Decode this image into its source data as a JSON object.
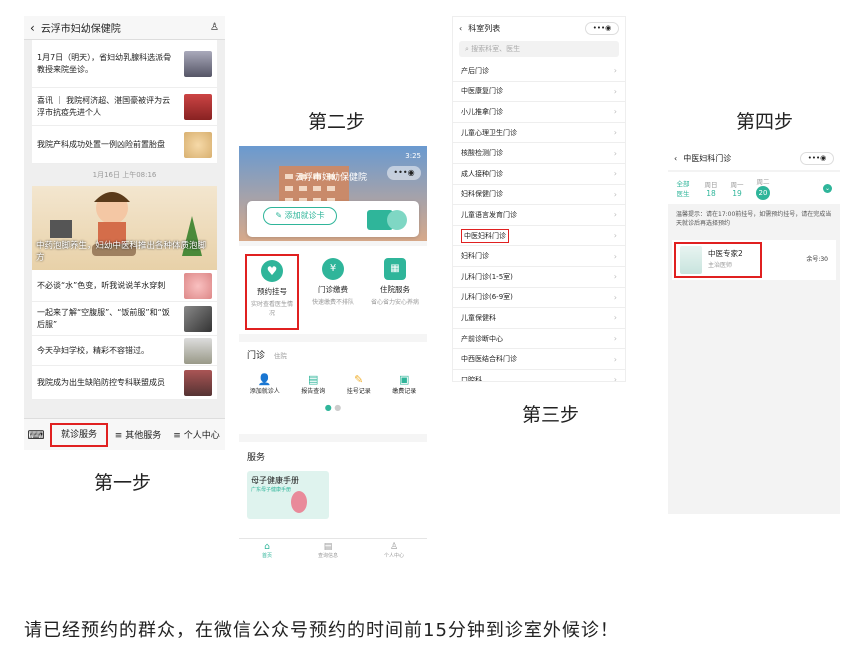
{
  "steps": {
    "s1": "第一步",
    "s2": "第二步",
    "s3": "第三步",
    "s4": "第四步"
  },
  "caption": "请已经预约的群众，在微信公众号预约的时间前15分钟到诊室外候诊！",
  "panel1": {
    "title": "云浮市妇幼保健院",
    "news_top": [
      "1月7日（明天），省妇幼乳腺科选派骨",
      "教授来院坐诊。"
    ],
    "news": [
      "喜讯 ｜ 我院柯济超、湛国豪被评为云浮市抗疫先进个人",
      "我院产科成功处置一例凶险前置胎盘"
    ],
    "timestamp": "1月16日 上午08:16",
    "banner_title": "中药泡脚养生，妇幼中医科推出各种体质泡脚方",
    "news2": [
      "不必谈“水”色变，听我说说羊水穿刺",
      "一起来了解“空腹服”、“饭前服”和“饭后服”",
      "今天孕妇学校，精彩不容错过。",
      "我院成为出生缺陷防控专科联盟成员"
    ],
    "menu": {
      "m1": "就诊服务",
      "m2": "≡ 其他服务",
      "m3": "≡ 个人中心"
    }
  },
  "panel2": {
    "header_title": "云浮市妇幼保健院",
    "time": "3:25",
    "add_card": "添加就诊卡",
    "services": [
      {
        "label": "预约挂号",
        "sub": "实时查看医生情况"
      },
      {
        "label": "门诊缴费",
        "sub": "快速缴费不排队"
      },
      {
        "label": "住院服务",
        "sub": "省心省力安心养病"
      }
    ],
    "tabs": {
      "t1": "门诊",
      "t2": "住院"
    },
    "quick": [
      "添加就诊人",
      "报告查询",
      "挂号记录",
      "缴费记录"
    ],
    "service_title": "服务",
    "handbook": "母子健康手册",
    "handbook_sub": "广东母子健康手册",
    "nav": {
      "n1": "首页",
      "n2": "查询信息",
      "n3": "个人中心"
    }
  },
  "panel3": {
    "title": "科室列表",
    "search_placeholder": "搜索科室、医生",
    "depts": [
      "产后门诊",
      "中医康复门诊",
      "小儿推拿门诊",
      "儿童心理卫生门诊",
      "核酸检测门诊",
      "成人接种门诊",
      "妇科保健门诊",
      "儿童语言发育门诊",
      "中医妇科门诊",
      "妇科门诊",
      "儿科门诊(1-5室)",
      "儿科门诊(6-9室)",
      "儿童保健科",
      "产前诊断中心",
      "中西医结合科门诊",
      "口腔科"
    ],
    "highlight_index": 8
  },
  "panel4": {
    "title": "中医妇科门诊",
    "all": "全部",
    "all2": "医生",
    "days": [
      {
        "w": "周日",
        "d": "18"
      },
      {
        "w": "周一",
        "d": "19"
      },
      {
        "w": "周二",
        "d": "20"
      }
    ],
    "notice": "温馨提示：请在17:00前挂号，如需预约挂号，请在完成当天就诊后再选择预约",
    "doctor": {
      "name": "中医专家2",
      "title": "主治医师",
      "remain": "余号:30"
    }
  },
  "colors": {
    "green": "#2fb59a",
    "red": "#e02020"
  }
}
